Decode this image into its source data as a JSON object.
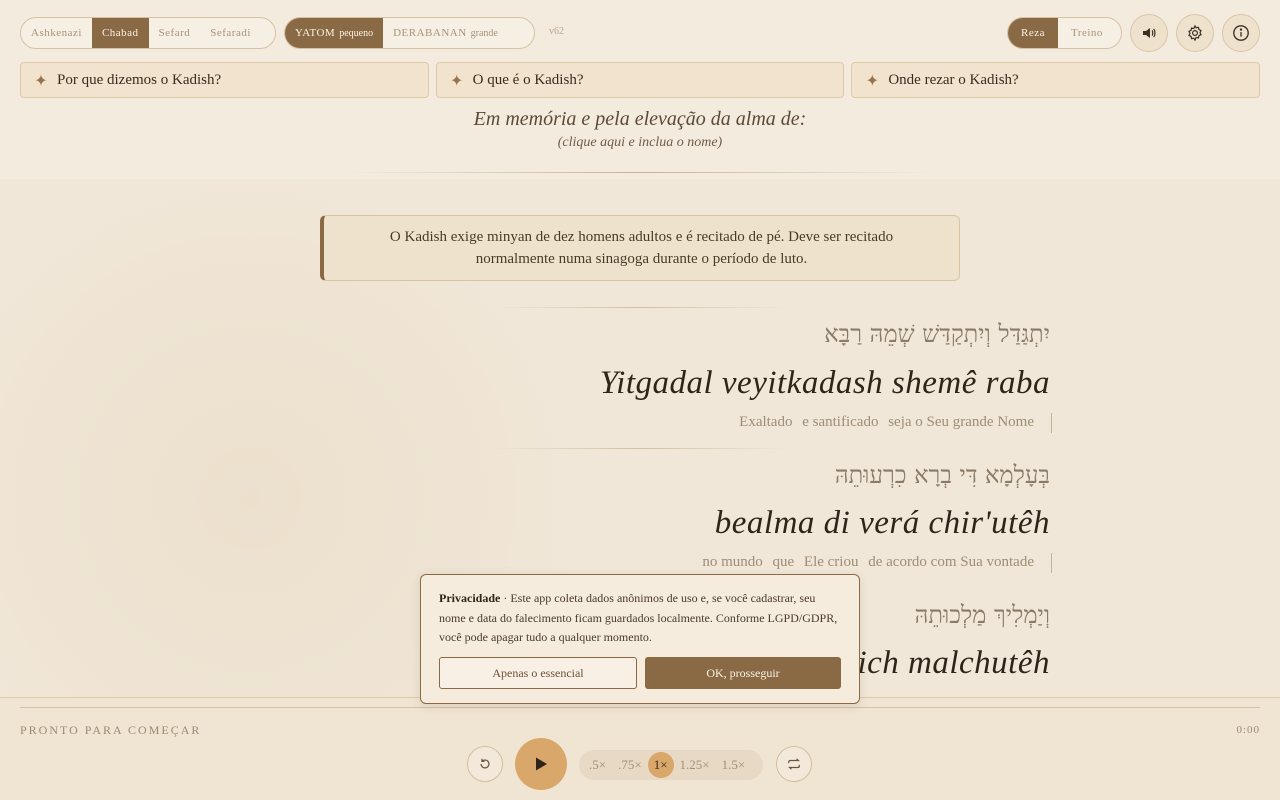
{
  "rites": [
    "Ashkenazi",
    "Chabad",
    "Sefard",
    "Sefaradi"
  ],
  "rite_active": "Chabad",
  "modes": [
    {
      "name": "YATOM",
      "size": "pequeno"
    },
    {
      "name": "DERABANAN",
      "size": "grande"
    }
  ],
  "version": "v62",
  "practice": [
    "Reza",
    "Treino"
  ],
  "icons": {
    "sound": "speaker-icon",
    "settings": "gear-icon",
    "info": "info-icon",
    "faq": "sparkle-icon",
    "restart": "restart-icon",
    "play": "play-icon",
    "loop": "repeat-icon"
  },
  "faq": [
    "Por que dizemos o Kadish?",
    "O que é o Kadish?",
    "Onde rezar o Kadish?"
  ],
  "memorial": {
    "title": "Em memória e pela elevação da alma de:",
    "hint": "(clique aqui e inclua o nome)"
  },
  "notice": "O Kadish exige minyan de dez homens adultos e é recitado de pé. Deve ser recitado normalmente numa sinagoga durante o período de luto.",
  "verses": [
    {
      "hebrew": "יִתְגַּדַּל וְיִתְקַדַּשׁ שְׁמֵהּ רַבָּא",
      "translit": "Yitgadal veyitkadash shemê raba",
      "translation": [
        "Exaltado",
        "e santificado",
        "seja o Seu grande Nome"
      ]
    },
    {
      "hebrew": "בְּעָלְמָא דִּי בְרָא כִרְעוּתֵהּ",
      "translit": "bealma di verá chir'utêh",
      "translation": [
        "no mundo",
        "que",
        "Ele criou",
        "de acordo com Sua vontade"
      ]
    },
    {
      "hebrew": "וְיַמְלִיךְ מַלְכוּתֵהּ",
      "translit": "veyamlich malchutêh",
      "translation": []
    }
  ],
  "player": {
    "status": "PRONTO PARA COMEÇAR",
    "time": "0:00",
    "speeds": [
      ".5×",
      ".75×",
      "1×",
      "1.25×",
      "1.5×"
    ],
    "speed_active": "1×"
  },
  "consent": {
    "label": "Privacidade",
    "text": " · Este app coleta dados anônimos de uso e, se você cadastrar, seu nome e data do falecimento ficam guardados localmente. Conforme LGPD/GDPR, você pode apagar tudo a qualquer momento.",
    "essential": "Apenas o essencial",
    "ok": "OK, prosseguir"
  },
  "colors": {
    "accent": "#8a6a45",
    "gold": "#d9a769",
    "background": "#f4ebdf"
  }
}
